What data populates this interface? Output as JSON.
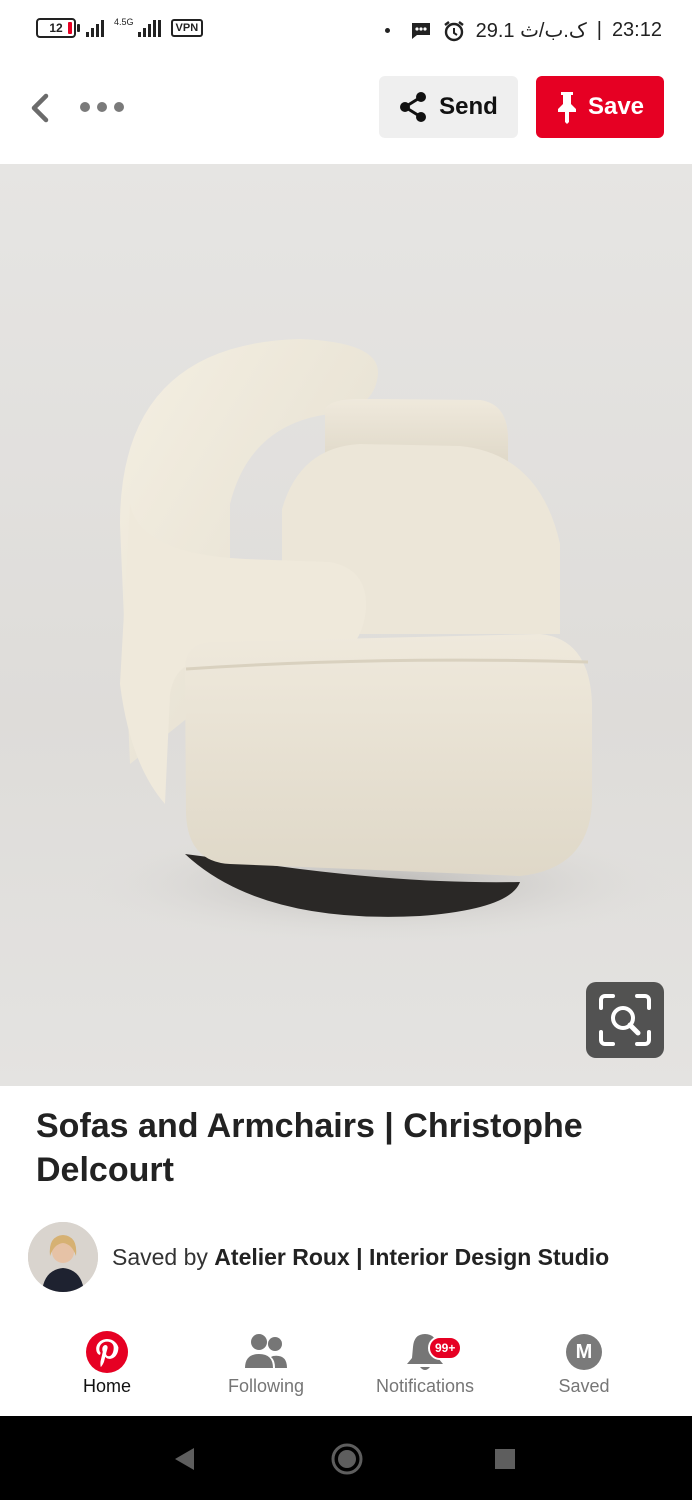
{
  "status_bar": {
    "battery": "12",
    "network": "4.5G",
    "vpn": "VPN",
    "date": "29.1 ک.ب/ث",
    "time": "23:12",
    "separator": "|"
  },
  "toolbar": {
    "send_label": "Send",
    "save_label": "Save",
    "save_color": "#e60023"
  },
  "pin": {
    "title": "Sofas and Armchairs | Christophe Delcourt",
    "saved_by_prefix": "Saved by",
    "saved_by_name": "Atelier Roux | Interior Design Studio"
  },
  "bottom_nav": {
    "items": [
      {
        "label": "Home",
        "icon": "pinterest-logo-icon",
        "active": true
      },
      {
        "label": "Following",
        "icon": "people-icon"
      },
      {
        "label": "Notifications",
        "icon": "bell-icon",
        "badge": "99+"
      },
      {
        "label": "Saved",
        "icon": "profile-initial-icon",
        "initial": "M"
      }
    ]
  },
  "icons": [
    "back-chevron-icon",
    "more-dots-icon",
    "share-icon",
    "pin-icon",
    "visual-search-icon"
  ]
}
